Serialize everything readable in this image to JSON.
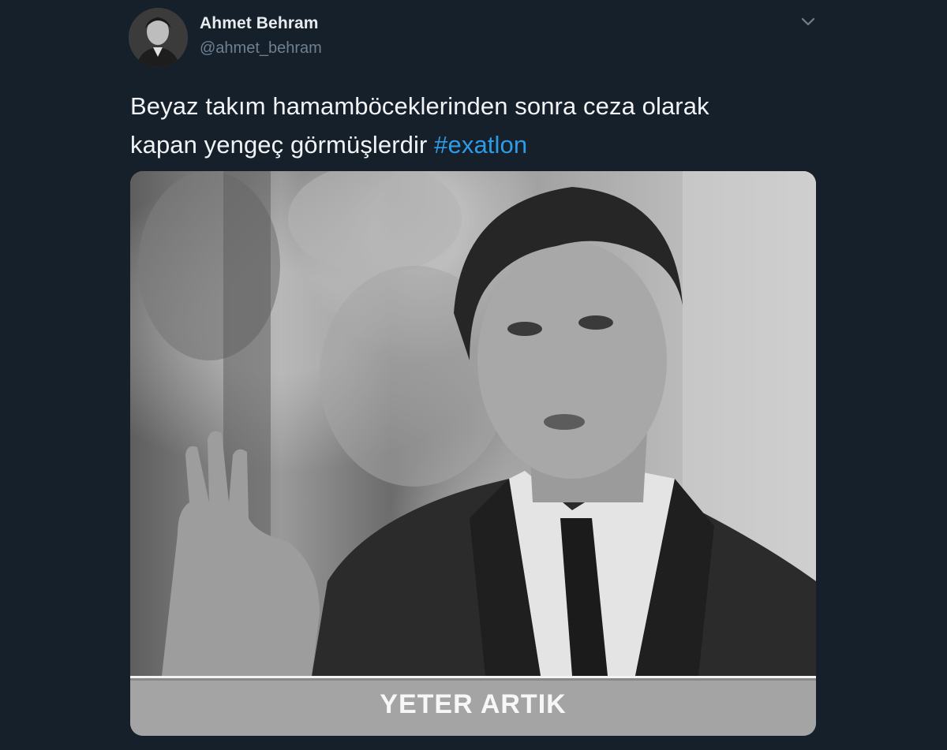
{
  "tweet": {
    "author": {
      "name": "Ahmet Behram",
      "handle": "@ahmet_behram"
    },
    "text_line1": "Beyaz takım hamamböceklerinden sonra ceza olarak",
    "text_line2": "kapan yengeç görmüşlerdir",
    "hashtag": "#exatlon",
    "media": {
      "caption": "YETER ARTIK"
    },
    "menu_icon": "chevron-down-icon"
  },
  "colors": {
    "background": "#15202b",
    "text": "#f1f3f5",
    "handle": "#6f8090",
    "hashtag": "#2d9ce8"
  }
}
